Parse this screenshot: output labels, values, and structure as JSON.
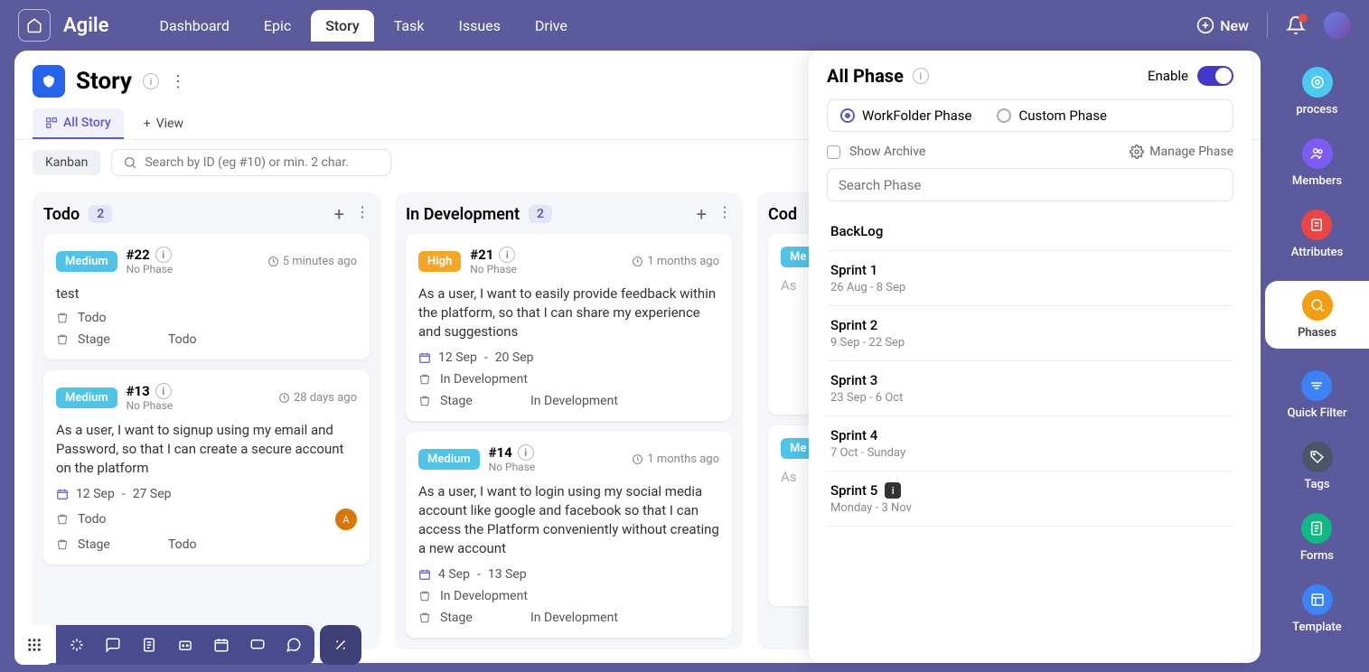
{
  "brand": "Agile",
  "nav": {
    "tabs": [
      "Dashboard",
      "Epic",
      "Story",
      "Task",
      "Issues",
      "Drive"
    ],
    "active": 2,
    "new_label": "New"
  },
  "page": {
    "title": "Story",
    "view_tabs": {
      "active": "All Story",
      "add": "View"
    },
    "kanban_label": "Kanban",
    "search_placeholder": "Search by ID (eg #10) or min. 2 char."
  },
  "columns": [
    {
      "title": "Todo",
      "count": "2",
      "cards": [
        {
          "priority": "Medium",
          "priorityClass": "medium",
          "id": "#22",
          "phase": "No Phase",
          "time": "5 minutes ago",
          "body": "test",
          "dates": null,
          "status": "Todo",
          "stage": "Stage",
          "stageVal": "Todo",
          "assignee": null
        },
        {
          "priority": "Medium",
          "priorityClass": "medium",
          "id": "#13",
          "phase": "No Phase",
          "time": "28 days ago",
          "body": "As a user, I want to signup using my email and Password, so that I can create a secure account on the platform",
          "dates": {
            "start": "12 Sep",
            "end": "27 Sep"
          },
          "status": "Todo",
          "stage": "Stage",
          "stageVal": "Todo",
          "assignee": "A"
        }
      ]
    },
    {
      "title": "In Development",
      "count": "2",
      "cards": [
        {
          "priority": "High",
          "priorityClass": "high",
          "id": "#21",
          "phase": "No Phase",
          "time": "1 months ago",
          "body": "As a user, I want to easily provide feedback within the platform, so that I can share my experience and suggestions",
          "dates": {
            "start": "12 Sep",
            "end": "20 Sep"
          },
          "status": "In Development",
          "stage": "Stage",
          "stageVal": "In Development",
          "assignee": null
        },
        {
          "priority": "Medium",
          "priorityClass": "medium",
          "id": "#14",
          "phase": "No Phase",
          "time": "1 months ago",
          "body": "As a user, I want to login using my social media account like google and facebook so that I can access the Platform conveniently without creating a new account",
          "dates": {
            "start": "4 Sep",
            "end": "13 Sep"
          },
          "status": "In Development",
          "stage": "Stage",
          "stageVal": "In Development",
          "assignee": null
        }
      ]
    },
    {
      "title": "Cod",
      "count": "",
      "cards": [
        {
          "priority": "Medium",
          "priorityClass": "medium",
          "partial": true
        },
        {
          "priority": "Medium",
          "priorityClass": "medium",
          "partial": true
        }
      ]
    }
  ],
  "phase_panel": {
    "title": "All Phase",
    "enable_label": "Enable",
    "type_options": {
      "workfolder": "WorkFolder Phase",
      "custom": "Custom Phase"
    },
    "show_archive": "Show Archive",
    "manage": "Manage Phase",
    "search_placeholder": "Search Phase",
    "items": [
      {
        "name": "BackLog",
        "dates": null
      },
      {
        "name": "Sprint 1",
        "dates": "26 Aug - 8 Sep"
      },
      {
        "name": "Sprint 2",
        "dates": "9 Sep - 22 Sep"
      },
      {
        "name": "Sprint 3",
        "dates": "23 Sep - 6 Oct"
      },
      {
        "name": "Sprint 4",
        "dates": "7 Oct - Sunday"
      },
      {
        "name": "Sprint 5",
        "dates": "Monday - 3 Nov",
        "badge": true
      }
    ]
  },
  "sidebar": [
    {
      "label": "process",
      "icon": "ic-process"
    },
    {
      "label": "Members",
      "icon": "ic-members"
    },
    {
      "label": "Attributes",
      "icon": "ic-attr"
    },
    {
      "label": "Phases",
      "icon": "ic-phases",
      "active": true
    },
    {
      "label": "Quick Filter",
      "icon": "ic-filter"
    },
    {
      "label": "Tags",
      "icon": "ic-tags"
    },
    {
      "label": "Forms",
      "icon": "ic-forms"
    },
    {
      "label": "Template",
      "icon": "ic-template"
    }
  ]
}
